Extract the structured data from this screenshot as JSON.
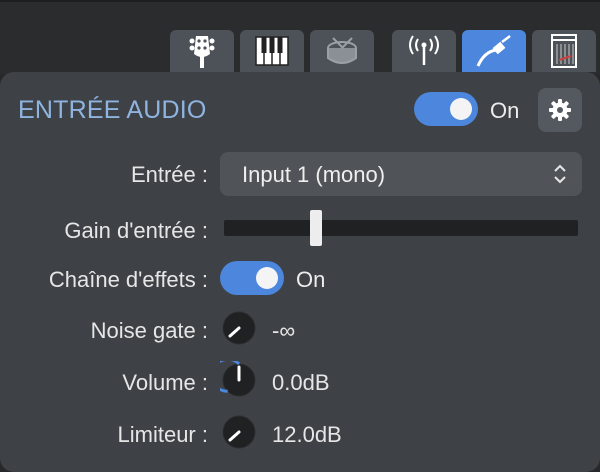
{
  "tabs": [
    {
      "id": "guitar",
      "icon": "guitar-headstock-icon",
      "active": false
    },
    {
      "id": "piano",
      "icon": "piano-keys-icon",
      "active": false
    },
    {
      "id": "drums",
      "icon": "drum-icon",
      "active": false
    },
    {
      "id": "antenna",
      "icon": "antenna-icon",
      "active": false
    },
    {
      "id": "cable",
      "icon": "audio-cable-icon",
      "active": true
    },
    {
      "id": "amp",
      "icon": "amp-icon",
      "active": false
    }
  ],
  "panel": {
    "title": "ENTRÉE AUDIO",
    "power_on_label": "On",
    "settings_icon": "gear-icon"
  },
  "rows": {
    "entree": {
      "label": "Entrée :",
      "value": "Input 1 (mono)"
    },
    "gain": {
      "label": "Gain d'entrée :",
      "level": 0.25
    },
    "chain": {
      "label": "Chaîne d'effets :",
      "state": "On"
    },
    "noise_gate": {
      "label": "Noise gate :",
      "value": "-∞"
    },
    "volume": {
      "label": "Volume :",
      "value": "0.0dB"
    },
    "limiteur": {
      "label": "Limiteur :",
      "value": "12.0dB"
    }
  },
  "colors": {
    "accent": "#4d86dd",
    "title": "#8fb4e0",
    "panel": "#3e4246",
    "tab": "#4d5258"
  }
}
